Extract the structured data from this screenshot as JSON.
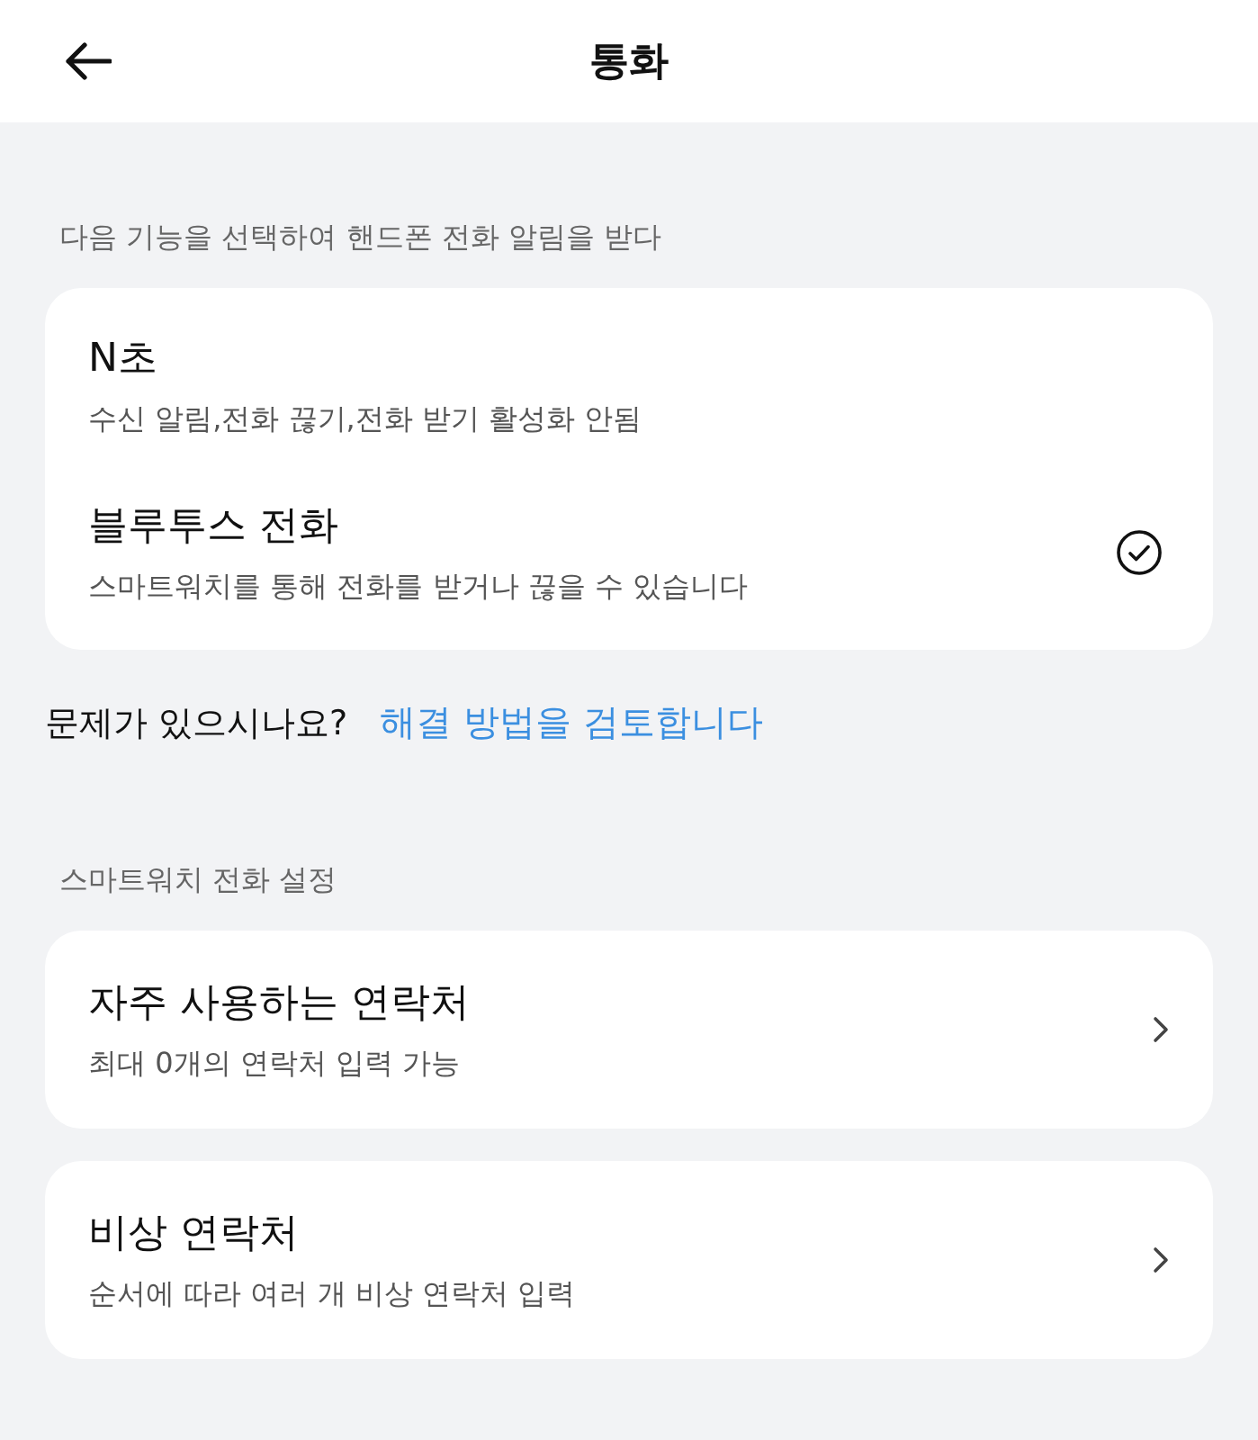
{
  "header": {
    "title": "통화"
  },
  "mode_section": {
    "label": "다음 기능을 선택하여 핸드폰 전화 알림을 받다",
    "options": [
      {
        "title": "N초",
        "subtitle": "수신 알림,전화 끊기,전화 받기 활성화 안됨",
        "selected": false
      },
      {
        "title": "블루투스 전화",
        "subtitle": "스마트워치를 통해 전화를 받거나 끊을 수 있습니다",
        "selected": true
      }
    ]
  },
  "help": {
    "question": "문제가 있으시나요?",
    "link": "해결 방법을 검토합니다"
  },
  "watch_section": {
    "label": "스마트워치 전화 설정",
    "items": [
      {
        "title": "자주 사용하는 연락처",
        "subtitle": "최대 0개의 연락처 입력 가능"
      },
      {
        "title": "비상 연락처",
        "subtitle": "순서에 따라 여러 개 비상 연락처 입력"
      }
    ]
  }
}
